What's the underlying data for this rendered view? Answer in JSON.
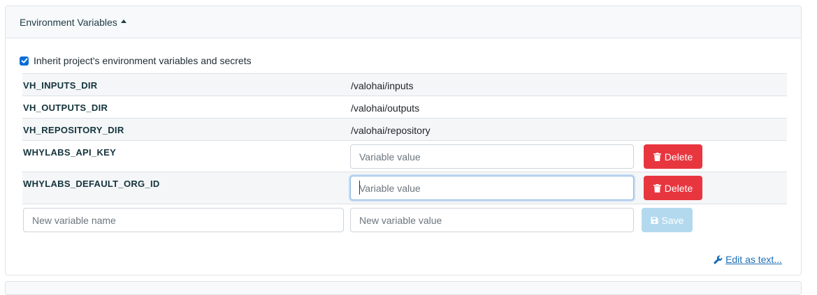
{
  "header": {
    "title": "Environment Variables"
  },
  "inherit": {
    "label": "Inherit project's environment variables and secrets",
    "checked": true
  },
  "variables": [
    {
      "name": "VH_INPUTS_DIR",
      "value": "/valohai/inputs"
    },
    {
      "name": "VH_OUTPUTS_DIR",
      "value": "/valohai/outputs"
    },
    {
      "name": "VH_REPOSITORY_DIR",
      "value": "/valohai/repository"
    }
  ],
  "editable": [
    {
      "name": "WHYLABS_API_KEY",
      "placeholder": "Variable value",
      "delete_label": "Delete"
    },
    {
      "name": "WHYLABS_DEFAULT_ORG_ID",
      "placeholder": "Variable value",
      "delete_label": "Delete"
    }
  ],
  "new_variable": {
    "name_placeholder": "New variable name",
    "value_placeholder": "New variable value",
    "save_label": "Save"
  },
  "edit_as_text": "Edit as text...",
  "colors": {
    "danger": "#e8363f",
    "primary": "#0a6dd9",
    "save_disabled": "#b3d9ef"
  }
}
